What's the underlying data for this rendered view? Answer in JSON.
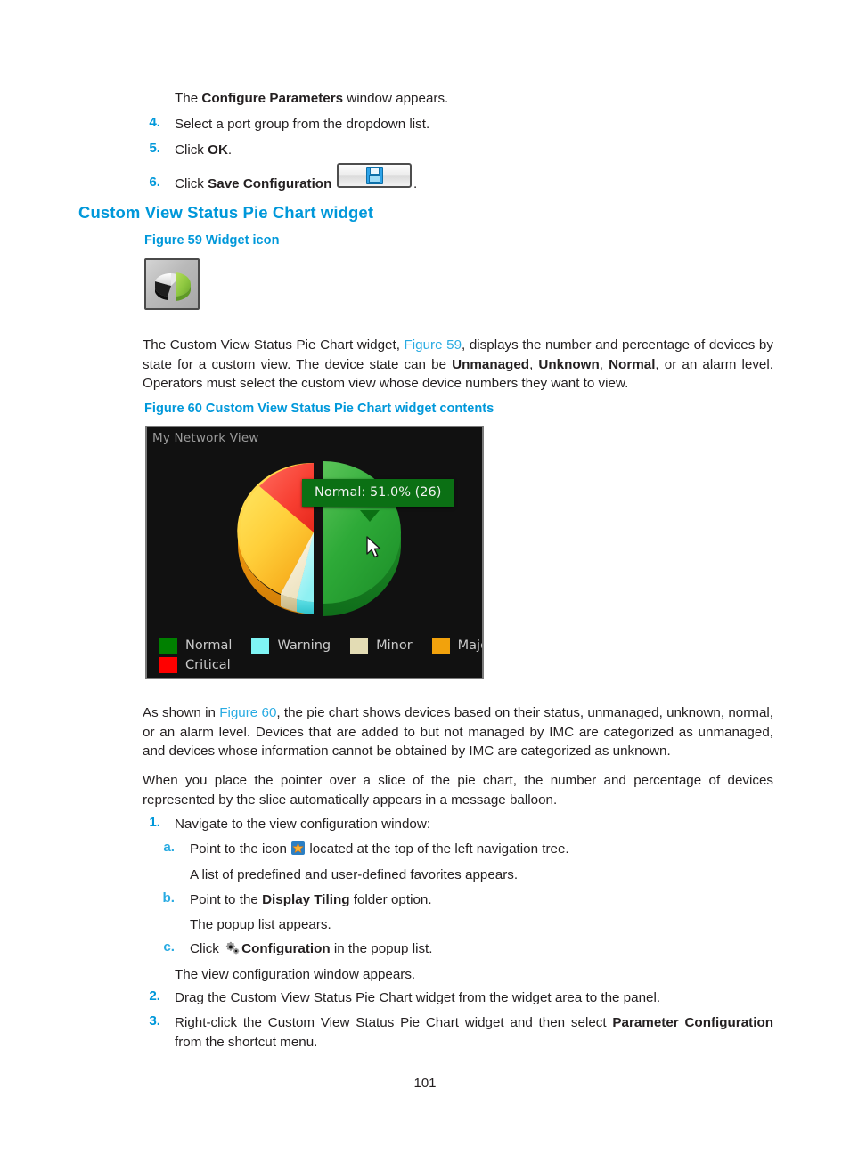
{
  "intro": {
    "line1_pre": "The ",
    "line1_bold": "Configure Parameters",
    "line1_post": " window appears."
  },
  "steps_top": [
    {
      "num": "4.",
      "pre": "Select a port group from the dropdown list.",
      "bold": "",
      "post": ""
    },
    {
      "num": "5.",
      "pre": "Click ",
      "bold": "OK",
      "post": "."
    },
    {
      "num": "6.",
      "pre": "Click ",
      "bold": "Save Configuration",
      "post": "."
    }
  ],
  "section": {
    "heading": "Custom View Status Pie Chart widget",
    "figure59_caption": "Figure 59 Widget icon",
    "figure60_caption": "Figure 60 Custom View Status Pie Chart widget contents"
  },
  "paragraph1": {
    "p1": "The Custom View Status Pie Chart widget, ",
    "link": "Figure 59",
    "p2": ", displays the number and percentage of devices by state for a custom view. The device state can be ",
    "b1": "Unmanaged",
    "p3": ", ",
    "b2": "Unknown",
    "p4": ", ",
    "b3": "Normal",
    "p5": ", or an alarm level. Operators must select the custom view whose device numbers they want to view."
  },
  "paragraph2": {
    "p1": "As shown in ",
    "link": "Figure 60",
    "p2": ", the pie chart shows devices based on their status, unmanaged, unknown, normal, or an alarm level. Devices that are added to but not managed by IMC are categorized as unmanaged, and devices whose information cannot be obtained by IMC are categorized as unknown."
  },
  "paragraph3": {
    "text": "When you place the pointer over a slice of the pie chart, the number and percentage of devices represented by the slice automatically appears in a message balloon."
  },
  "steps_bottom": [
    {
      "num": "1.",
      "text": "Navigate to the view configuration window:"
    },
    {
      "num": "a.",
      "pre": "Point to the icon ",
      "post": " located at the top of the left navigation tree."
    },
    {
      "num": "",
      "text": "A list of predefined and user-defined favorites appears."
    },
    {
      "num": "b.",
      "pre": "Point to the ",
      "bold": "Display Tiling",
      "post": " folder option."
    },
    {
      "num": "",
      "text": "The popup list appears."
    },
    {
      "num": "c.",
      "pre": "Click ",
      "bold": "Configuration",
      "post": " in the popup list."
    },
    {
      "num": "",
      "text": "The view configuration window appears."
    },
    {
      "num": "2.",
      "text": "Drag the Custom View Status Pie Chart widget from the widget area to the panel."
    },
    {
      "num": "3.",
      "pre": "Right-click the Custom View Status Pie Chart widget and then select ",
      "bold": "Parameter Configuration",
      "post": " from the shortcut menu."
    }
  ],
  "widget": {
    "title": "My Network View",
    "tooltip": "Normal: 51.0% (26)",
    "cursor": "arrow-cursor"
  },
  "chart_data": {
    "type": "pie",
    "title": "My Network View",
    "categories": [
      "Normal",
      "Warning",
      "Minor",
      "Major",
      "Critical"
    ],
    "values": [
      51.0,
      4.0,
      3.5,
      27.5,
      14.0
    ],
    "counts": [
      26,
      2,
      2,
      14,
      7
    ],
    "colors": [
      "#008000",
      "#7ff4f4",
      "#e3dcb4",
      "#f2a20c",
      "#ff0000"
    ],
    "highlight": {
      "label": "Normal",
      "percent": "51.0%",
      "count": 26,
      "exploded": true
    },
    "legend_position": "bottom-left",
    "background": "#111111",
    "depth_3d": true,
    "annotations": [
      "Normal: 51.0% (26)"
    ]
  },
  "footer": {
    "page_number": "101"
  },
  "colors": {
    "accent_blue": "#0098da",
    "link_blue": "#29abe2",
    "text": "#231f20",
    "widget_bg": "#111111",
    "tooltip_bg": "#0b7014"
  }
}
